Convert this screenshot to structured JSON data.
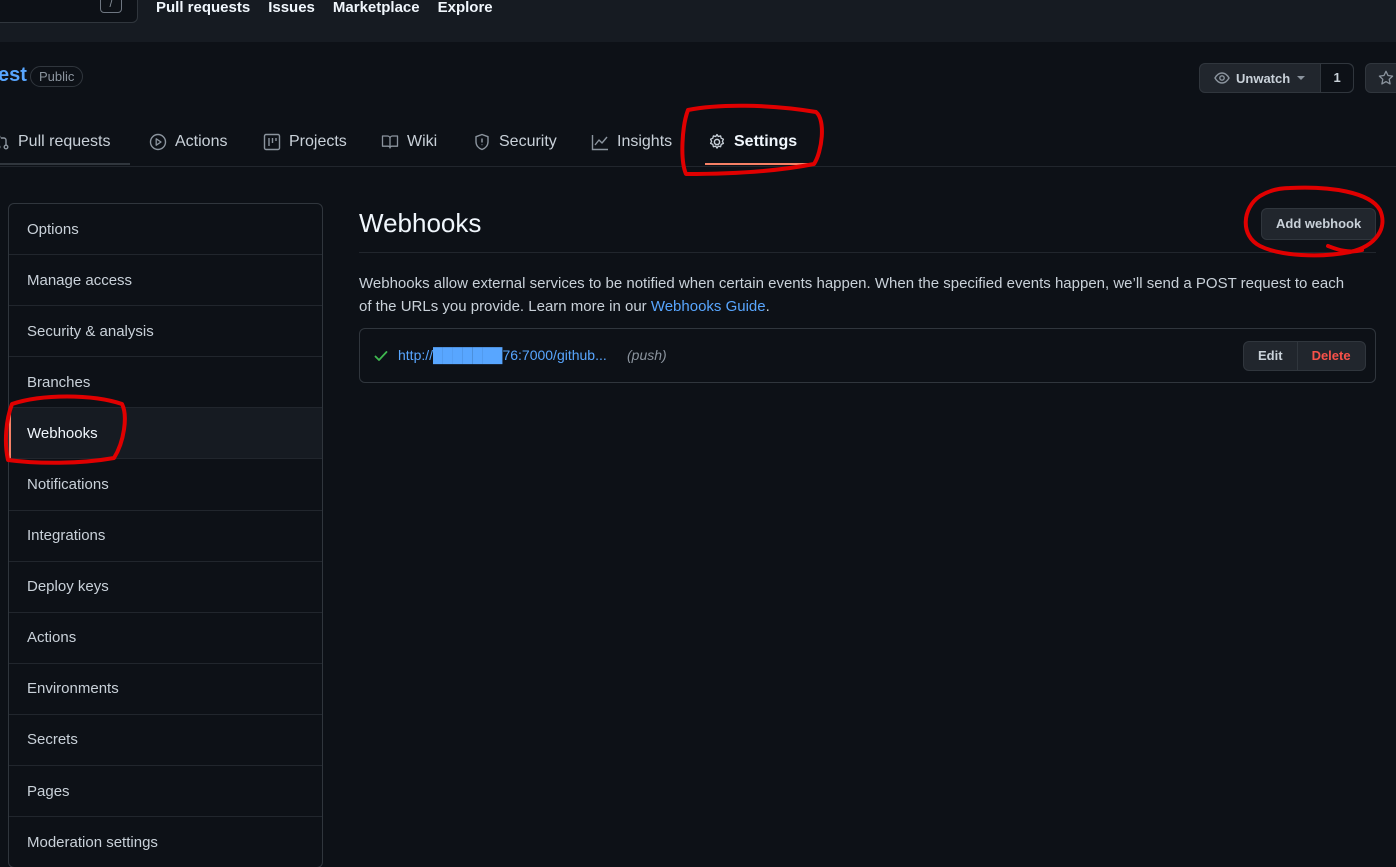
{
  "topnav": {
    "slash_key": "/",
    "items": [
      "Pull requests",
      "Issues",
      "Marketplace",
      "Explore"
    ]
  },
  "repo": {
    "name": "est",
    "visibility": "Public",
    "watch_label": "Unwatch",
    "watch_count": "1"
  },
  "tabs": [
    {
      "label": "Pull requests",
      "icon": "pull-request-icon"
    },
    {
      "label": "Actions",
      "icon": "play-icon"
    },
    {
      "label": "Projects",
      "icon": "project-icon"
    },
    {
      "label": "Wiki",
      "icon": "book-icon"
    },
    {
      "label": "Security",
      "icon": "shield-icon"
    },
    {
      "label": "Insights",
      "icon": "graph-icon"
    },
    {
      "label": "Settings",
      "icon": "gear-icon",
      "selected": true
    }
  ],
  "sidebar": {
    "items": [
      {
        "label": "Options"
      },
      {
        "label": "Manage access"
      },
      {
        "label": "Security & analysis"
      },
      {
        "label": "Branches"
      },
      {
        "label": "Webhooks",
        "selected": true
      },
      {
        "label": "Notifications"
      },
      {
        "label": "Integrations"
      },
      {
        "label": "Deploy keys"
      },
      {
        "label": "Actions"
      },
      {
        "label": "Environments"
      },
      {
        "label": "Secrets"
      },
      {
        "label": "Pages"
      },
      {
        "label": "Moderation settings"
      }
    ]
  },
  "main": {
    "title": "Webhooks",
    "add_button": "Add webhook",
    "description": "Webhooks allow external services to be notified when certain events happen. When the specified events happen, we’ll send a POST request to each of the URLs you provide. Learn more in our ",
    "guide_link": "Webhooks Guide",
    "description_end": ".",
    "webhook": {
      "url": "http://███████76:7000/github...",
      "event": "(push)",
      "status": "check-icon",
      "edit_label": "Edit",
      "delete_label": "Delete"
    }
  },
  "colors": {
    "background": "#0d1117",
    "link": "#58a6ff",
    "danger": "#f85149",
    "success": "#3fb950",
    "annotation": "#e00000"
  }
}
